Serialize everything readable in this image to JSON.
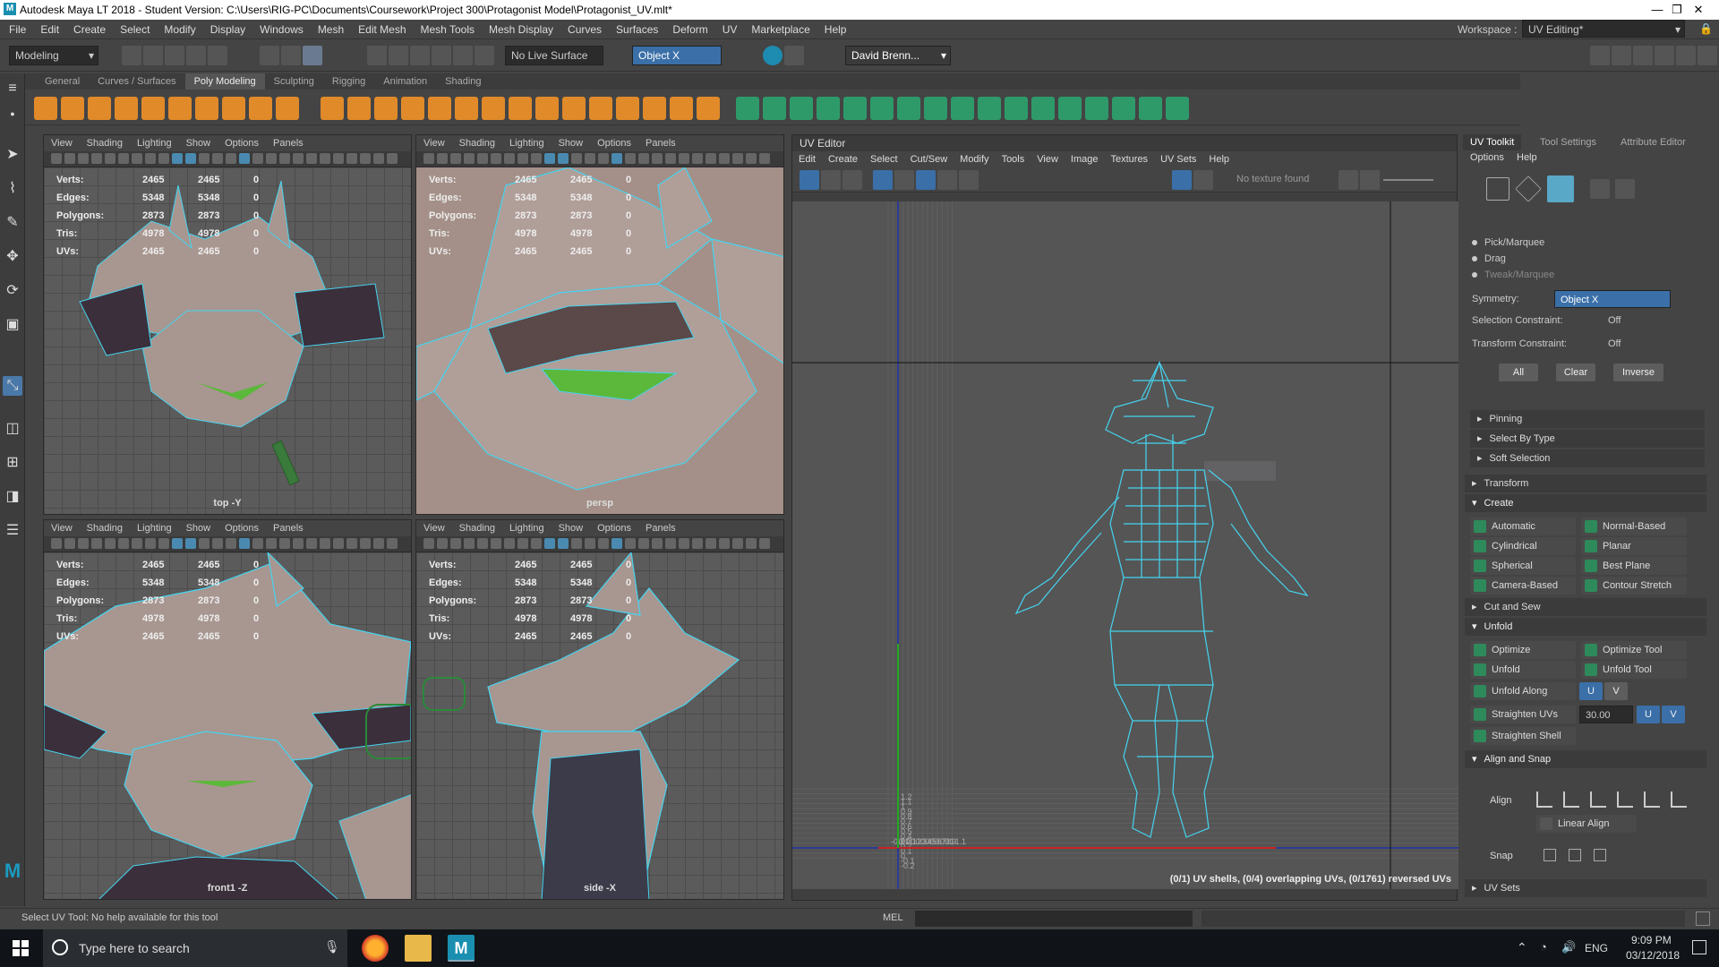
{
  "window": {
    "title": "Autodesk Maya LT 2018 - Student Version: C:\\Users\\RIG-PC\\Documents\\Coursework\\Project 300\\Protagonist Model\\Protagonist_UV.mlt*",
    "min": "—",
    "max": "❐",
    "close": "✕"
  },
  "menu": {
    "items": [
      "File",
      "Edit",
      "Create",
      "Select",
      "Modify",
      "Display",
      "Windows",
      "Mesh",
      "Edit Mesh",
      "Mesh Tools",
      "Mesh Display",
      "Curves",
      "Surfaces",
      "Deform",
      "UV",
      "Marketplace",
      "Help"
    ],
    "workspace_label": "Workspace :",
    "workspace_value": "UV Editing*"
  },
  "toolbar": {
    "mode": "Modeling",
    "live_surface": "No Live Surface",
    "symmetry": "Object X",
    "user": "David Brenn..."
  },
  "shelf": {
    "tabs": [
      "General",
      "Curves / Surfaces",
      "Poly Modeling",
      "Sculpting",
      "Rigging",
      "Animation",
      "Shading"
    ],
    "active": "Poly Modeling"
  },
  "viewport_menu": [
    "View",
    "Shading",
    "Lighting",
    "Show",
    "Options",
    "Panels"
  ],
  "hud": {
    "rows": [
      {
        "k": "Verts:",
        "a": "2465",
        "b": "2465",
        "c": "0"
      },
      {
        "k": "Edges:",
        "a": "5348",
        "b": "5348",
        "c": "0"
      },
      {
        "k": "Polygons:",
        "a": "2873",
        "b": "2873",
        "c": "0"
      },
      {
        "k": "Tris:",
        "a": "4978",
        "b": "4978",
        "c": "0"
      },
      {
        "k": "UVs:",
        "a": "2465",
        "b": "2465",
        "c": "0"
      }
    ]
  },
  "viewports": [
    {
      "camera": "top -Y"
    },
    {
      "camera": "persp"
    },
    {
      "camera": "front1 -Z"
    },
    {
      "camera": "side -X"
    }
  ],
  "uv_editor": {
    "title": "UV Editor",
    "menu": [
      "Edit",
      "Create",
      "Select",
      "Cut/Sew",
      "Modify",
      "Tools",
      "View",
      "Image",
      "Textures",
      "UV Sets",
      "Help"
    ],
    "no_texture": "No texture found",
    "status": "(0/1) UV shells, (0/4) overlapping UVs, (0/1761) reversed UVs",
    "x_ticks": [
      "-0.2",
      "-0.1",
      "0",
      "0.1",
      "0.2",
      "0.3",
      "0.4",
      "0.5",
      "0.6",
      "0.7",
      "0.8",
      "0.9",
      "1",
      "1.1"
    ],
    "y_ticks": [
      "1.2",
      "1.1",
      "1",
      "0.9",
      "0.8",
      "0.7",
      "0.6",
      "0.5",
      "0.4",
      "0.3",
      "0.2",
      "0.1",
      "0",
      "-0.1",
      "-0.2"
    ]
  },
  "right_panel": {
    "tabs": [
      "UV Toolkit",
      "Tool Settings",
      "Attribute Editor"
    ],
    "sub_menu": [
      "Options",
      "Help"
    ],
    "modes": [
      "Pick/Marquee",
      "Drag",
      "Tweak/Marquee"
    ],
    "symmetry_label": "Symmetry:",
    "symmetry_value": "Object X",
    "sel_constraint_label": "Selection Constraint:",
    "sel_constraint_value": "Off",
    "trans_constraint_label": "Transform Constraint:",
    "trans_constraint_value": "Off",
    "sel_buttons": [
      "All",
      "Clear",
      "Inverse"
    ],
    "sections": {
      "pinning": "Pinning",
      "select_by_type": "Select By Type",
      "soft_selection": "Soft Selection",
      "transform": "Transform",
      "create": "Create",
      "cut_sew": "Cut and Sew",
      "unfold": "Unfold",
      "align_snap": "Align and Snap",
      "uv_sets": "UV Sets"
    },
    "create_tools": [
      "Automatic",
      "Normal-Based",
      "Cylindrical",
      "Planar",
      "Spherical",
      "Best Plane",
      "Camera-Based",
      "Contour Stretch"
    ],
    "unfold_tools": [
      "Optimize",
      "Optimize Tool",
      "Unfold",
      "Unfold Tool"
    ],
    "unfold_along": "Unfold Along",
    "straighten_uvs": "Straighten UVs",
    "straighten_value": "30.00",
    "straighten_shell": "Straighten Shell",
    "u": "U",
    "v": "V",
    "align_label": "Align",
    "linear_align": "Linear Align",
    "snap_label": "Snap"
  },
  "status": {
    "help": "Select UV Tool: No help available for this tool",
    "mel": "MEL"
  },
  "taskbar": {
    "search_placeholder": "Type here to search",
    "lang": "ENG",
    "time": "9:09 PM",
    "date": "03/12/2018"
  },
  "colors": {
    "wire": "#45d4f0",
    "accent_orange": "#e08a2a",
    "selection_blue": "#3a6fa8",
    "green": "#5fa83a"
  }
}
